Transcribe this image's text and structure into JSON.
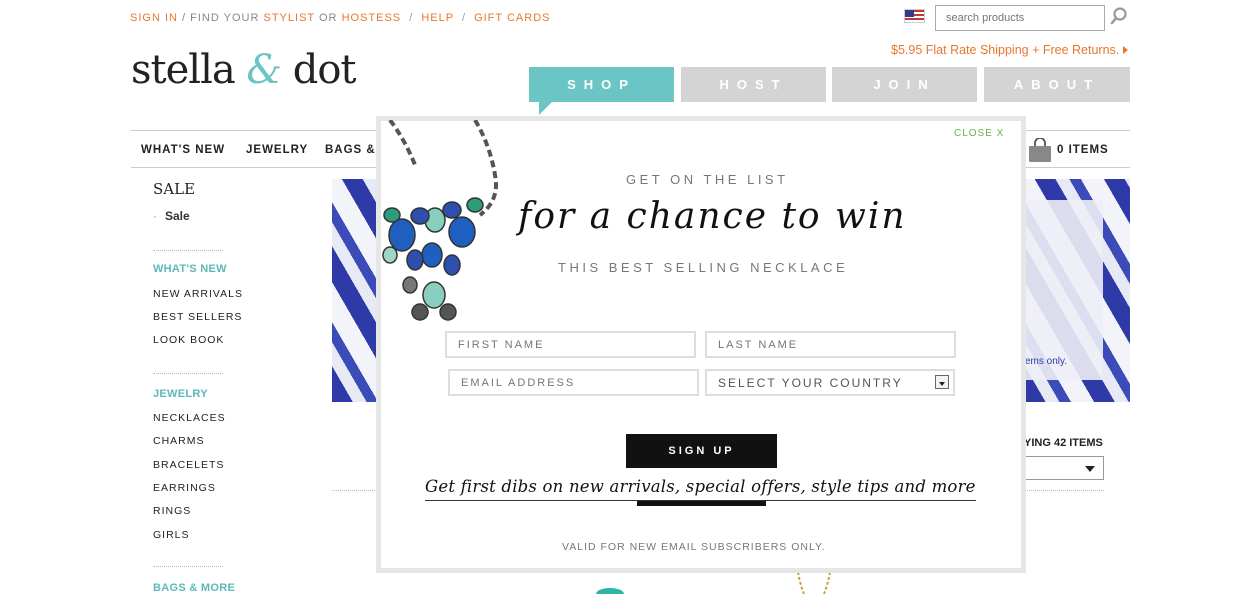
{
  "topbar": {
    "sign_in": "SIGN IN",
    "find_your": "/ FIND YOUR",
    "stylist": "STYLIST",
    "or": "OR",
    "hostess": "HOSTESS",
    "sep1": "/",
    "help": "HELP",
    "sep2": "/",
    "gift_cards": "GIFT CARDS"
  },
  "search": {
    "placeholder": "search products"
  },
  "promo": "$5.95 Flat Rate Shipping + Free Returns.",
  "logo": {
    "part1": "stella ",
    "amp": "&",
    "part2": " dot"
  },
  "main_nav": [
    "SHOP",
    "HOST",
    "JOIN",
    "ABOUT"
  ],
  "category_nav": [
    "WHAT'S NEW",
    "JEWELRY",
    "BAGS &"
  ],
  "cart_label": "0 ITEMS",
  "sidebar": {
    "title": "SALE",
    "sale_dot": "·",
    "sale_item": "Sale",
    "sections": [
      {
        "heading": "WHAT'S NEW",
        "links": [
          "NEW ARRIVALS",
          "BEST SELLERS",
          "LOOK BOOK"
        ]
      },
      {
        "heading": "JEWELRY",
        "links": [
          "NECKLACES",
          "CHARMS",
          "BRACELETS",
          "EARRINGS",
          "RINGS",
          "GIRLS"
        ]
      },
      {
        "heading": "BAGS & MORE",
        "links": []
      }
    ]
  },
  "banner_text": "ems only.",
  "showing_text": "YING 42 ITEMS",
  "modal": {
    "close": "CLOSE X",
    "eyebrow": "GET ON THE LIST",
    "headline": "for a chance to win",
    "subhead": "THIS BEST SELLING NECKLACE",
    "first_name_placeholder": "FIRST NAME",
    "last_name_placeholder": "LAST NAME",
    "email_placeholder": "EMAIL ADDRESS",
    "country_value": "SELECT YOUR COUNTRY",
    "signup_label": "SIGN UP",
    "tagline": "Get first dibs on new arrivals, special offers, style tips and more",
    "disclaimer": "VALID FOR NEW EMAIL SUBSCRIBERS ONLY."
  },
  "colors": {
    "accent_teal": "#6cc5c5",
    "orange": "#e8772e",
    "nav_gray": "#d4d4d4",
    "close_green": "#6ab04c"
  }
}
